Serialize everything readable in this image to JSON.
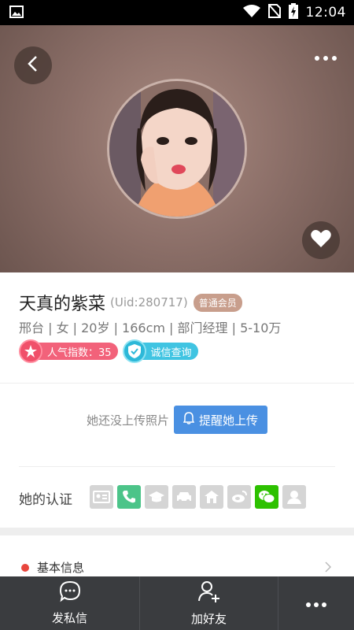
{
  "status_bar": {
    "time": "12:04"
  },
  "profile": {
    "name": "天真的紫菜",
    "uid": "(Uid:280717)",
    "member_badge": "普通会员",
    "info_line": "邢台 | 女 | 20岁 | 166cm | 部门经理 | 5-10万",
    "popularity_label": "人气指数：35",
    "credit_label": "诚信查询"
  },
  "photos": {
    "empty_text": "她还没上传照片",
    "remind_button": "提醒她上传"
  },
  "certification": {
    "label": "她的认证",
    "items": [
      "id-card",
      "phone",
      "education",
      "car",
      "house",
      "weibo",
      "wechat",
      "avatar-verify"
    ]
  },
  "basic_info": {
    "title": "基本信息"
  },
  "bottom_bar": {
    "message": "发私信",
    "add_friend": "加好友"
  },
  "colors": {
    "accent_blue": "#4a90e2",
    "popularity_red": "#f2627a",
    "credit_cyan": "#40c4e2",
    "member_badge": "#c89e8c"
  }
}
